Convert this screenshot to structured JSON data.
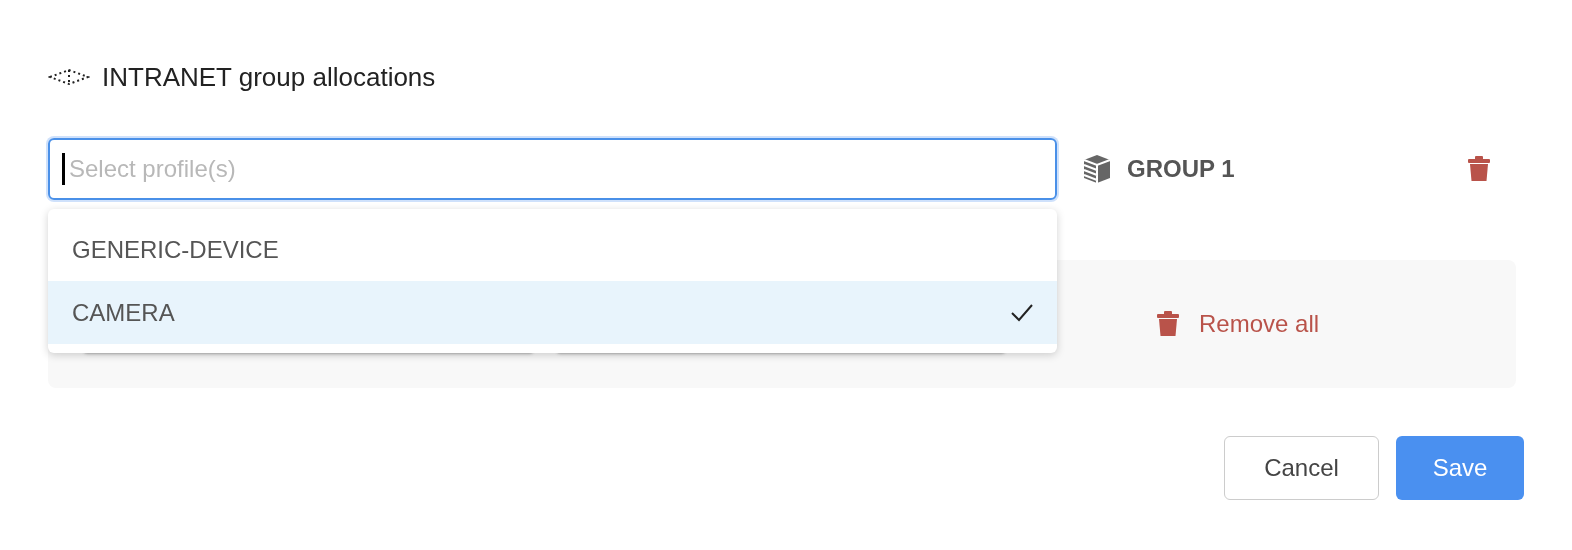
{
  "title": "INTRANET group allocations",
  "profile_select": {
    "placeholder": "Select profile(s)",
    "options": [
      {
        "label": "GENERIC-DEVICE",
        "selected": false
      },
      {
        "label": "CAMERA",
        "selected": true
      }
    ]
  },
  "group": {
    "label": "GROUP 1"
  },
  "remove_all": "Remove all",
  "buttons": {
    "cancel": "Cancel",
    "save": "Save"
  }
}
